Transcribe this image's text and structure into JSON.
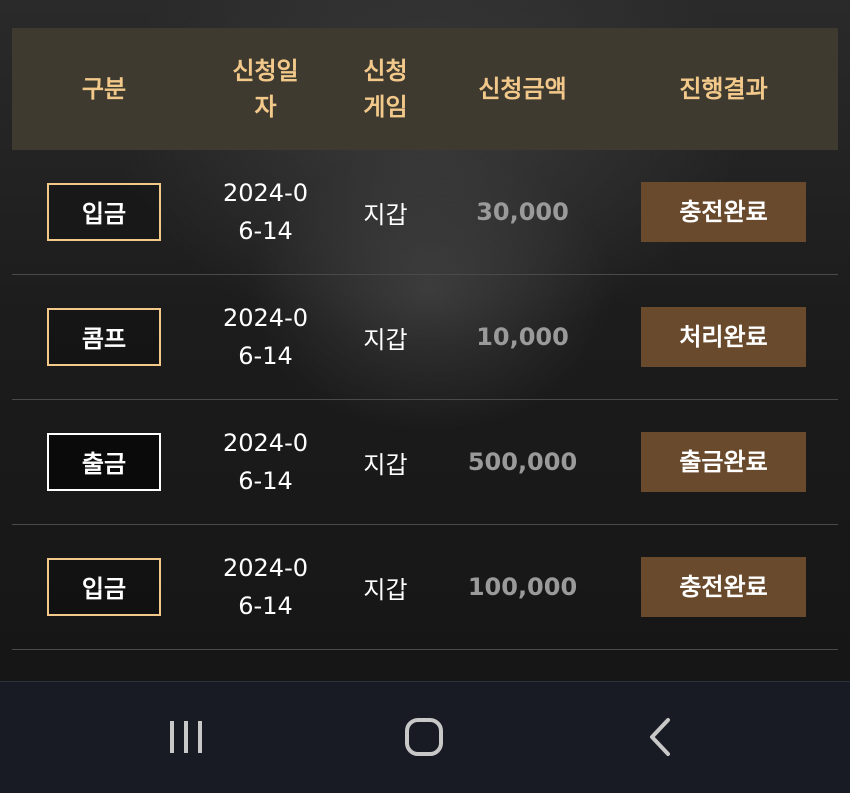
{
  "table": {
    "headers": [
      "구분",
      "신청일자",
      "신청게임",
      "신청금액",
      "진행결과"
    ],
    "rows": [
      {
        "type": "입금",
        "date": "2024-06-14",
        "game": "지갑",
        "amount": "30,000",
        "status": "충전완료"
      },
      {
        "type": "콤프",
        "date": "2024-06-14",
        "game": "지갑",
        "amount": "10,000",
        "status": "처리완료"
      },
      {
        "type": "출금",
        "date": "2024-06-14",
        "game": "지갑",
        "amount": "500,000",
        "status": "출금완료"
      },
      {
        "type": "입금",
        "date": "2024-06-14",
        "game": "지갑",
        "amount": "100,000",
        "status": "충전완료"
      }
    ]
  },
  "colors": {
    "header_bg": "#3f3a30",
    "header_text": "#f2c98a",
    "status_bg": "#6a4a2c",
    "amount_text": "#9a9a9a"
  },
  "navbar": {
    "icons": [
      "recent-apps-icon",
      "home-icon",
      "back-icon"
    ]
  }
}
